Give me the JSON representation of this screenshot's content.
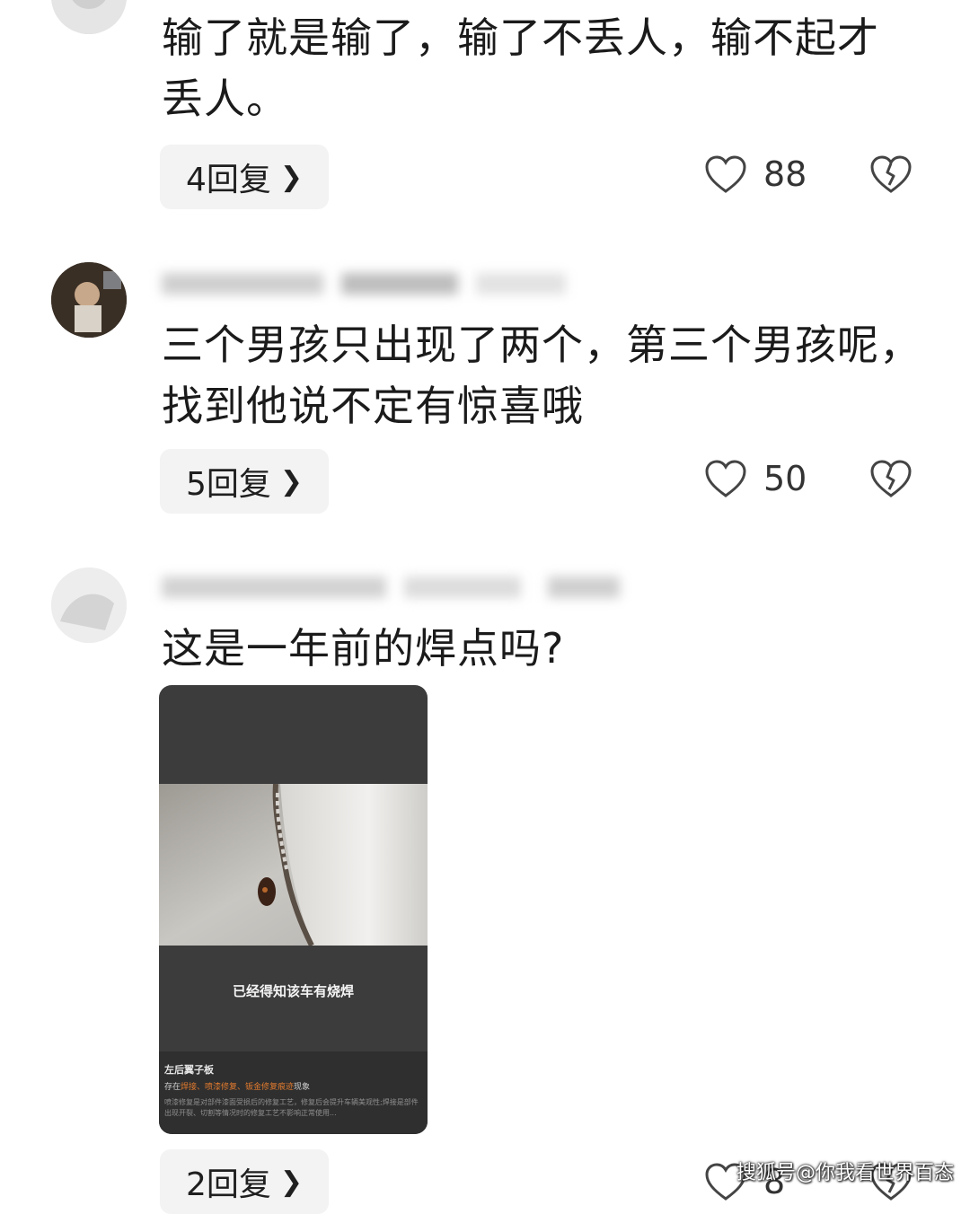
{
  "comments": [
    {
      "text_line1": "输了就是输了，输了不丢人，输不起才",
      "text_line2": "丢人。",
      "reply_label": "4回复",
      "likes": "88"
    },
    {
      "text_line1": "三个男孩只出现了两个，第三个男孩呢，",
      "text_line2": "找到他说不定有惊喜哦",
      "reply_label": "5回复",
      "likes": "50"
    },
    {
      "text_line1": "这是一年前的焊点吗?",
      "reply_label": "2回复",
      "likes": "8",
      "image": {
        "caption": "已经得知该车有烧焊",
        "panel_title": "左后翼子板",
        "panel_line_prefix": "存在",
        "panel_tags": "焊接、喷漆修复、钣金修复痕迹",
        "panel_line_suffix": "现象",
        "panel_desc": "喷漆修复是对部件漆面受损后的修复工艺，修复后会提升车辆美观性;焊接是部件出现开裂、切割等情况时的修复工艺不影响正常使用..."
      }
    }
  ],
  "icons": {
    "like": "heart-outline-icon",
    "dislike": "broken-heart-icon",
    "reply_arrow": "chevron-right-icon"
  },
  "watermark": "搜狐号@你我看世界百态",
  "colors": {
    "pill_bg": "#f3f3f3",
    "icon_gray": "#444444",
    "highlight_orange": "#e07a2e"
  }
}
